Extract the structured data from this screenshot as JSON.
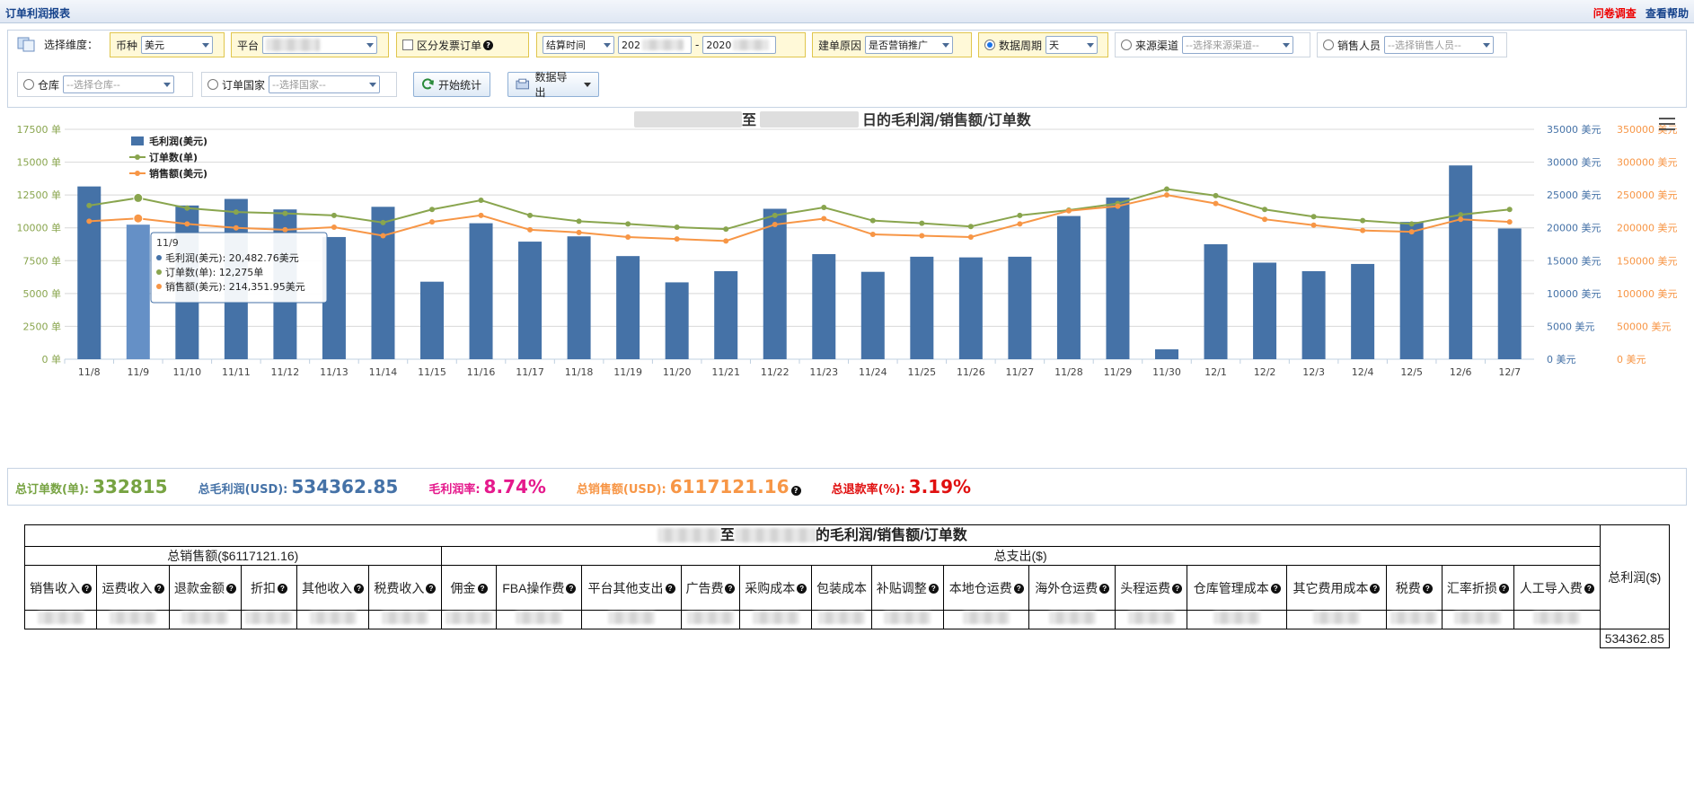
{
  "header": {
    "title": "订单利润报表",
    "survey_link": "问卷调查",
    "help_link": "查看帮助"
  },
  "filters": {
    "dimension_label": "选择维度：",
    "currency_label": "币种",
    "currency_value": "美元",
    "platform_label": "平台",
    "invoice_label": "区分发票订单",
    "date_type_value": "结算时间",
    "date_start": "202",
    "date_sep": "-",
    "date_end": "2020",
    "reason_label": "建单原因",
    "reason_value": "是否营销推广",
    "period_label": "数据周期",
    "period_value": "天",
    "source_label": "来源渠道",
    "source_placeholder": "--选择来源渠道--",
    "sales_label": "销售人员",
    "sales_placeholder": "--选择销售人员--",
    "warehouse_label": "仓库",
    "warehouse_placeholder": "--选择仓库--",
    "country_label": "订单国家",
    "country_placeholder": "--选择国家--",
    "start_button": "开始统计",
    "export_button": "数据导出"
  },
  "colors": {
    "bar": "#4572a7",
    "orders": "#89a54e",
    "sales": "#f79646",
    "grid": "#d8d8d8",
    "accent_blue": "#4572a7",
    "summary_orders": "#77a342",
    "summary_profit": "#4572a7",
    "summary_rate": "#e5198c",
    "summary_sales": "#f79646",
    "summary_refund": "#e01010"
  },
  "chart_data": {
    "type": "bar",
    "title_mid": "至",
    "title_end": "日的毛利润/销售额/订单数",
    "categories": [
      "11/8",
      "11/9",
      "11/10",
      "11/11",
      "11/12",
      "11/13",
      "11/14",
      "11/15",
      "11/16",
      "11/17",
      "11/18",
      "11/19",
      "11/20",
      "11/21",
      "11/22",
      "11/23",
      "11/24",
      "11/25",
      "11/26",
      "11/27",
      "11/28",
      "11/29",
      "11/30",
      "12/1",
      "12/2",
      "12/3",
      "12/4",
      "12/5",
      "12/6",
      "12/7"
    ],
    "series": [
      {
        "name": "毛利润(美元)",
        "type": "bar",
        "axis": "profit",
        "values": [
          26300,
          20483,
          23400,
          24400,
          22800,
          18600,
          23200,
          11800,
          20700,
          17900,
          18700,
          15700,
          11700,
          13400,
          22900,
          16000,
          13300,
          15600,
          15500,
          15600,
          21800,
          24600,
          1500,
          17500,
          14700,
          13400,
          14500,
          20900,
          29500,
          19900
        ]
      },
      {
        "name": "订单数(单)",
        "type": "line",
        "axis": "orders",
        "values": [
          11700,
          12275,
          11500,
          11200,
          11100,
          10950,
          10400,
          11400,
          12100,
          10950,
          10500,
          10300,
          10050,
          9900,
          10950,
          11550,
          10550,
          10350,
          10100,
          10950,
          11350,
          11850,
          12950,
          12450,
          11400,
          10850,
          10550,
          10300,
          11000,
          11400
        ]
      },
      {
        "name": "销售额(美元)",
        "type": "line",
        "axis": "sales",
        "values": [
          210000,
          214352,
          206000,
          200000,
          197000,
          201000,
          188000,
          209000,
          219000,
          197000,
          193000,
          186000,
          183000,
          180000,
          205000,
          214000,
          190000,
          188000,
          186000,
          206000,
          226000,
          233000,
          250000,
          237000,
          213000,
          204000,
          196000,
          194000,
          213000,
          209000
        ]
      }
    ],
    "axes": {
      "orders": {
        "min": 0,
        "max": 17500,
        "ticks": [
          "0 单",
          "2500 单",
          "5000 单",
          "7500 单",
          "10000 单",
          "12500 单",
          "15000 单",
          "17500 单"
        ]
      },
      "profit": {
        "min": 0,
        "max": 35000,
        "ticks": [
          "0 美元",
          "5000 美元",
          "10000 美元",
          "15000 美元",
          "20000 美元",
          "25000 美元",
          "30000 美元",
          "35000 美元"
        ]
      },
      "sales": {
        "min": 0,
        "max": 350000,
        "ticks": [
          "0 美元",
          "50000 美元",
          "100000 美元",
          "150000 美元",
          "200000 美元",
          "250000 美元",
          "300000 美元",
          "350000 美元"
        ]
      }
    },
    "grid": true,
    "legend": "top-left",
    "tooltip": {
      "date": "11/9",
      "profit": "毛利润(美元): 20,482.76美元",
      "orders": "订单数(单): 12,275单",
      "sales": "销售额(美元): 214,351.95美元"
    }
  },
  "summary": {
    "orders_label": "总订单数(单):",
    "orders_value": "332815",
    "profit_label": "总毛利润(USD):",
    "profit_value": "534362.85",
    "rate_label": "毛利润率:",
    "rate_value": "8.74%",
    "sales_label": "总销售额(USD):",
    "sales_value": "6117121.16",
    "refund_label": "总退款率(%):",
    "refund_value": "3.19%"
  },
  "table": {
    "title_mid": "至",
    "title_end": "的毛利润/销售额/订单数",
    "total_sales_header": "总销售额($6117121.16)",
    "total_expense_header": "总支出($)",
    "total_profit_header": "总利润($)",
    "income_columns": [
      "销售收入",
      "运费收入",
      "退款金额",
      "折扣",
      "其他收入",
      "税费收入"
    ],
    "expense_columns": [
      "佣金",
      "FBA操作费",
      "平台其他支出",
      "广告费",
      "采购成本",
      "包装成本",
      "补贴调整",
      "本地仓运费",
      "海外仓运费",
      "头程运费",
      "仓库管理成本",
      "其它费用成本",
      "税费",
      "汇率折损",
      "人工导入费"
    ],
    "total_profit_value": "534362.85"
  }
}
